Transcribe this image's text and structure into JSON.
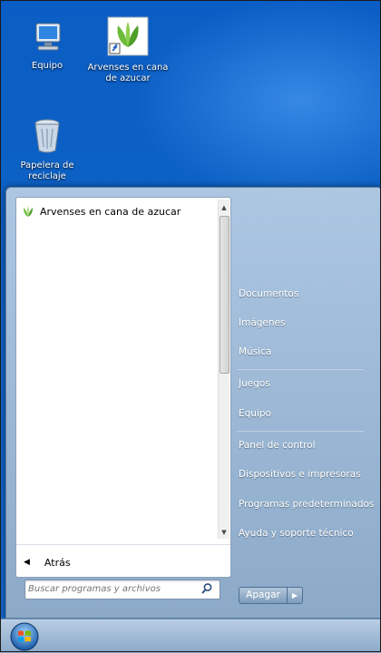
{
  "desktop": {
    "icons": [
      {
        "label": "Equipo",
        "icon": "computer-icon"
      },
      {
        "label": "Arvenses en cana de azucar",
        "icon": "plant-app-icon"
      },
      {
        "label": "Papelera de reciclaje",
        "icon": "recycle-bin-icon"
      }
    ]
  },
  "start_menu": {
    "programs": [
      {
        "label": "Arvenses en cana de azucar",
        "icon": "plant-app-icon"
      }
    ],
    "back_label": "Atrás",
    "search": {
      "placeholder": "Buscar programas y archivos",
      "value": ""
    },
    "right_items": [
      "Documentos",
      "Imágenes",
      "Música",
      "Juegos",
      "Equipo",
      "Panel de control",
      "Dispositivos e impresoras",
      "Programas predeterminados",
      "Ayuda y soporte técnico"
    ],
    "shutdown_label": "Apagar"
  },
  "taskbar": {
    "start_button": "windows-orb-icon"
  },
  "colors": {
    "desktop": "#0b5fc2",
    "menu_right": "#9fb7cf",
    "accent_green": "#6dbb3a"
  }
}
